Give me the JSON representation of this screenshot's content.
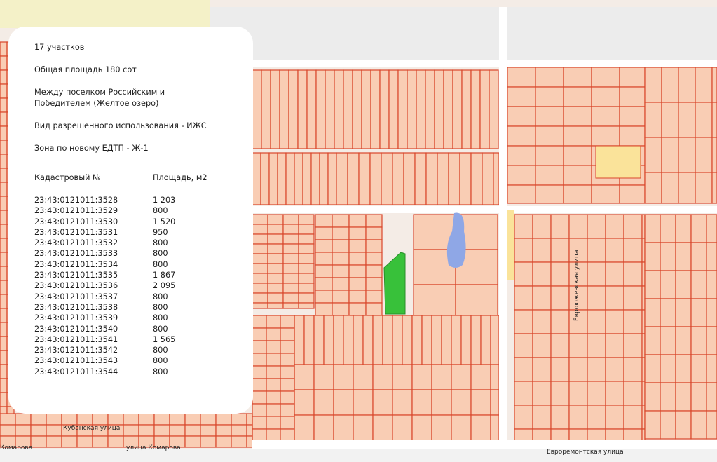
{
  "info": {
    "plots": "17 участков",
    "area_total": "Общая площадь 180 сот",
    "location_line1": "Между поселком Российским и",
    "location_line2": "Победителем (Желтое озеро)",
    "permitted_use": "Вид разрешенного использования - ИЖС",
    "zone": "Зона по новому ЕДТП - Ж-1",
    "col_cadastral": "Кадастровый №",
    "col_area": "Площадь, м2"
  },
  "parcels": [
    {
      "id": "23:43:0121011:3528",
      "area": "1 203"
    },
    {
      "id": "23:43:0121011:3529",
      "area": "800"
    },
    {
      "id": "23:43:0121011:3530",
      "area": "1 520"
    },
    {
      "id": "23:43:0121011:3531",
      "area": "950"
    },
    {
      "id": "23:43:0121011:3532",
      "area": "800"
    },
    {
      "id": "23:43:0121011:3533",
      "area": "800"
    },
    {
      "id": "23:43:0121011:3534",
      "area": "800"
    },
    {
      "id": "23:43:0121011:3535",
      "area": "1 867"
    },
    {
      "id": "23:43:0121011:3536",
      "area": "2 095"
    },
    {
      "id": "23:43:0121011:3537",
      "area": "800"
    },
    {
      "id": "23:43:0121011:3538",
      "area": "800"
    },
    {
      "id": "23:43:0121011:3539",
      "area": "800"
    },
    {
      "id": "23:43:0121011:3540",
      "area": "800"
    },
    {
      "id": "23:43:0121011:3541",
      "area": "1 565"
    },
    {
      "id": "23:43:0121011:3542",
      "area": "800"
    },
    {
      "id": "23:43:0121011:3543",
      "area": "800"
    },
    {
      "id": "23:43:0121011:3544",
      "area": "800"
    }
  ],
  "map": {
    "street_1": "Евроремонтская улица",
    "street_2": "улица Комарова",
    "street_3": "Кубанская улица",
    "street_4": "Комарова",
    "street_5": "Евроюжевская улица",
    "colors": {
      "background": "#f4ece6",
      "parcel_fill": "#f9cdb4",
      "parcel_border": "#d9472b",
      "highlight": "#38c13a",
      "lake": "#8fa7e6",
      "yellow_parcel": "#fae39a",
      "road": "#ffffff"
    }
  }
}
